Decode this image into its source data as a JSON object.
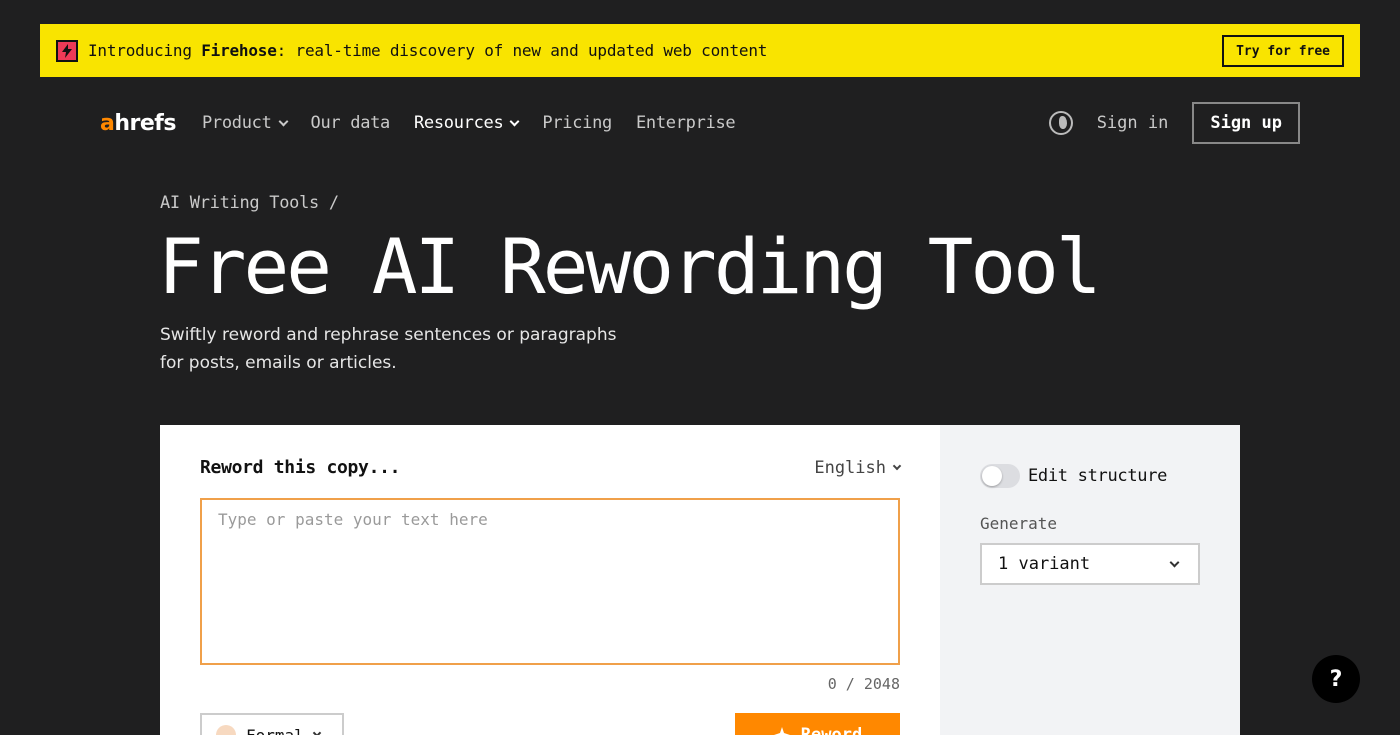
{
  "banner": {
    "prefix": "Introducing ",
    "brand": "Firehose",
    "suffix": ": real-time discovery of new and updated web content",
    "cta": "Try for free",
    "icon": "lightning-icon"
  },
  "nav": {
    "logo_accent": "a",
    "logo_rest": "hrefs",
    "items": [
      {
        "label": "Product",
        "dropdown": true
      },
      {
        "label": "Our data",
        "dropdown": false
      },
      {
        "label": "Resources",
        "dropdown": true
      },
      {
        "label": "Pricing",
        "dropdown": false
      },
      {
        "label": "Enterprise",
        "dropdown": false
      }
    ],
    "signin": "Sign in",
    "signup": "Sign up"
  },
  "hero": {
    "breadcrumb": "AI Writing Tools /",
    "title": "Free AI Rewording Tool",
    "subtitle": "Swiftly reword and rephrase sentences or paragraphs for posts, emails or articles."
  },
  "editor": {
    "heading": "Reword this copy...",
    "language": "English",
    "placeholder": "Type or paste your text here",
    "value": "",
    "counter": "0 / 2048",
    "tone": "Formal",
    "submit": "Reword"
  },
  "options": {
    "edit_structure_label": "Edit structure",
    "edit_structure_on": false,
    "generate_label": "Generate",
    "generate_value": "1 variant"
  },
  "help": "?",
  "colors": {
    "background": "#1f1f20",
    "banner": "#f9e400",
    "accent": "#ff8800",
    "input_border": "#f0a04a"
  }
}
